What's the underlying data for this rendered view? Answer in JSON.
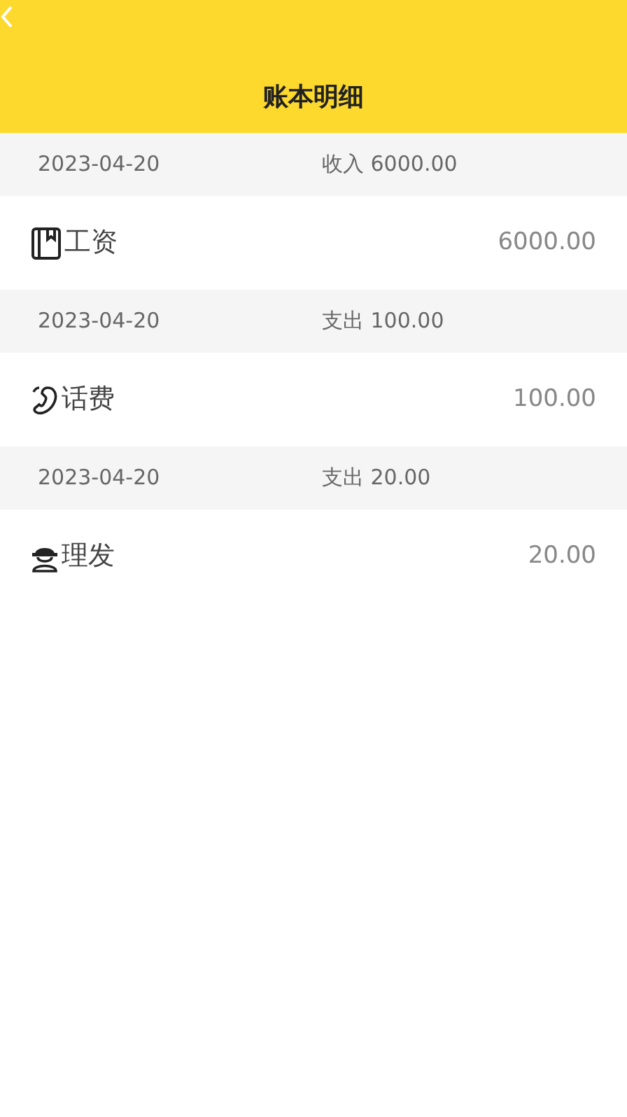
{
  "header": {
    "title": "账本明细"
  },
  "entries": [
    {
      "date": "2023-04-20",
      "summary": "收入 6000.00",
      "kind": "book",
      "category": "工资",
      "amount": "6000.00"
    },
    {
      "date": "2023-04-20",
      "summary": "支出 100.00",
      "kind": "phone",
      "category": "话费",
      "amount": "100.00"
    },
    {
      "date": "2023-04-20",
      "summary": "支出 20.00",
      "kind": "person",
      "category": "理发",
      "amount": "20.00"
    }
  ]
}
